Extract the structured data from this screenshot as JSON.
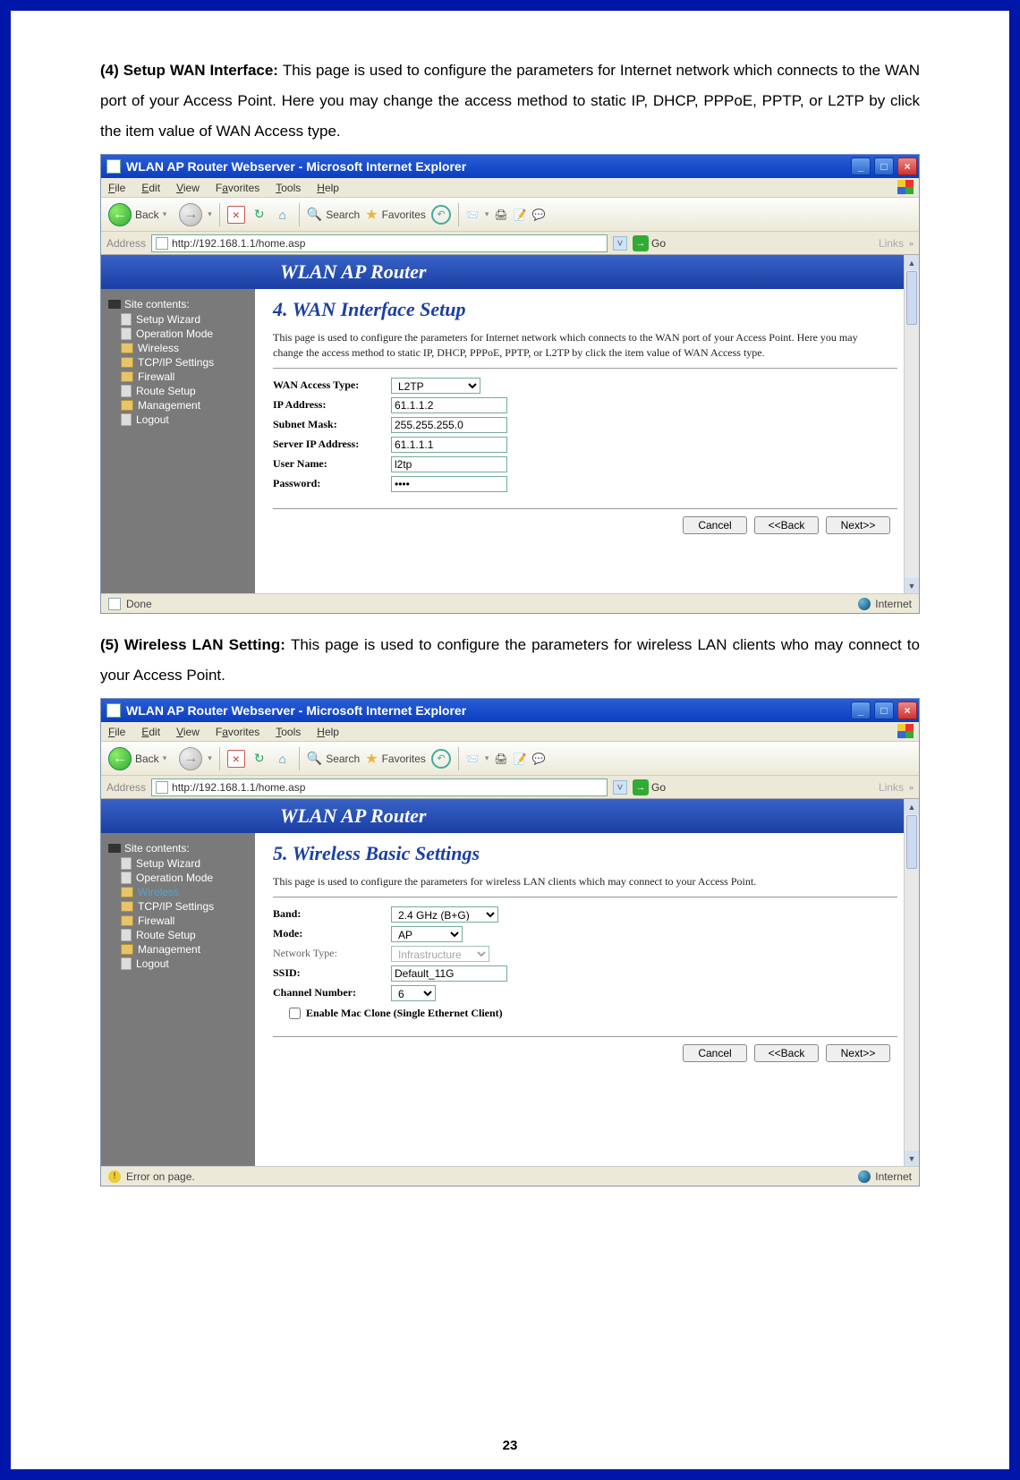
{
  "section4": {
    "heading": "(4) Setup WAN Interface: ",
    "text": "This page is used to configure the parameters for Internet network which connects to the WAN port of your Access Point. Here you may change the access method to static IP, DHCP, PPPoE, PPTP, or L2TP by click the item value of WAN Access type."
  },
  "section5": {
    "heading": "(5) Wireless LAN Setting: ",
    "text": "This page is used to configure the parameters for wireless LAN clients who may connect to your Access Point."
  },
  "page_number": "23",
  "ie": {
    "title": "WLAN AP Router Webserver - Microsoft Internet Explorer",
    "menu": {
      "file": "File",
      "edit": "Edit",
      "view": "View",
      "fav": "Favorites",
      "tools": "Tools",
      "help": "Help"
    },
    "toolbar": {
      "back": "Back",
      "search": "Search",
      "favorites": "Favorites"
    },
    "address_label": "Address",
    "url": "http://192.168.1.1/home.asp",
    "go": "Go",
    "links": "Links",
    "status_done": "Done",
    "status_error": "Error on page.",
    "zone": "Internet"
  },
  "router": {
    "banner": "WLAN AP Router",
    "sidebar": {
      "header": "Site contents:",
      "items": [
        "Setup Wizard",
        "Operation Mode",
        "Wireless",
        "TCP/IP Settings",
        "Firewall",
        "Route Setup",
        "Management",
        "Logout"
      ]
    }
  },
  "screen4": {
    "title": "4. WAN Interface Setup",
    "intro": "This page is used to configure the parameters for Internet network which connects to the WAN port of your Access Point. Here you may change the access method to static IP, DHCP, PPPoE, PPTP, or L2TP by click the item value of WAN Access type.",
    "labels": {
      "wan_type": "WAN Access Type:",
      "ip": "IP Address:",
      "subnet": "Subnet Mask:",
      "server_ip": "Server IP Address:",
      "user": "User Name:",
      "pass": "Password:"
    },
    "values": {
      "wan_type": "L2TP",
      "ip": "61.1.1.2",
      "subnet": "255.255.255.0",
      "server_ip": "61.1.1.1",
      "user": "l2tp",
      "pass": "••••"
    },
    "buttons": {
      "cancel": "Cancel",
      "back": "<<Back",
      "next": "Next>>"
    }
  },
  "screen5": {
    "title": "5. Wireless Basic Settings",
    "intro": "This page is used to configure the parameters for wireless LAN clients which may connect to your Access Point.",
    "labels": {
      "band": "Band:",
      "mode": "Mode:",
      "nettype": "Network Type:",
      "ssid": "SSID:",
      "channel": "Channel Number:",
      "macclone": "Enable Mac Clone (Single Ethernet Client)"
    },
    "values": {
      "band": "2.4 GHz (B+G)",
      "mode": "AP",
      "nettype": "Infrastructure",
      "ssid": "Default_11G",
      "channel": "6"
    },
    "buttons": {
      "cancel": "Cancel",
      "back": "<<Back",
      "next": "Next>>"
    }
  }
}
